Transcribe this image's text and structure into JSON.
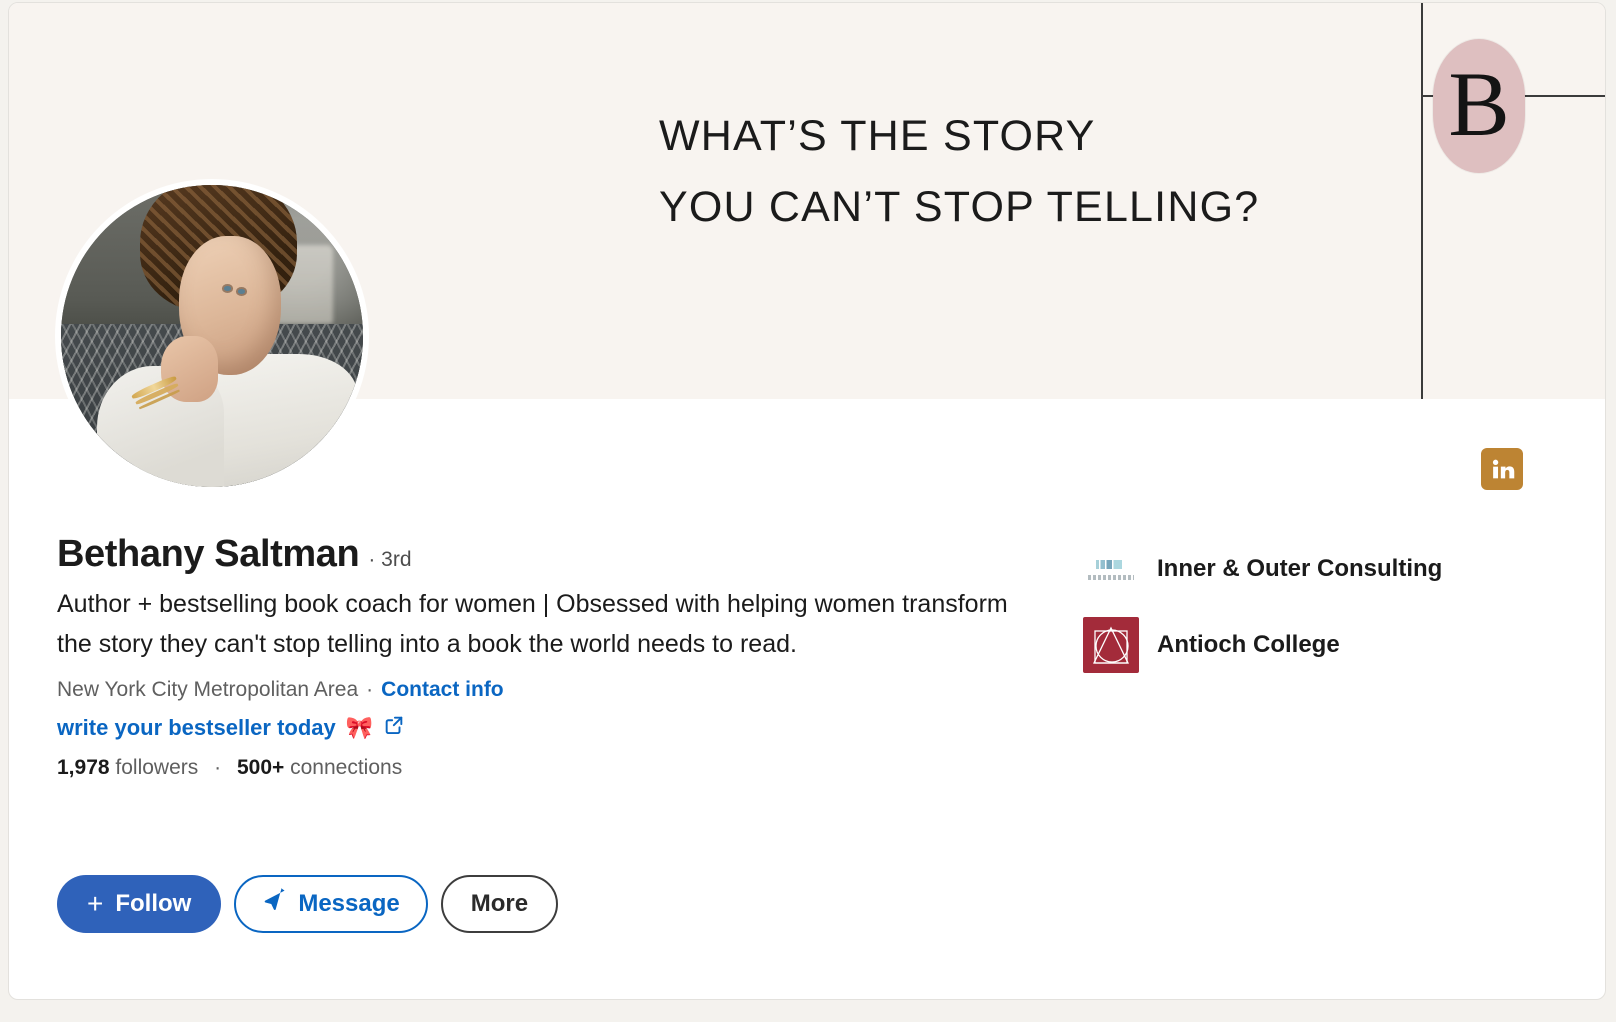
{
  "banner": {
    "headline_line1": "WHAT’S THE STORY",
    "headline_line2": "YOU CAN’T STOP TELLING?",
    "monogram_letter": "B",
    "background_color": "#f8f4f0",
    "monogram_color": "#debfc0"
  },
  "badge": {
    "icon": "linkedin-icon",
    "color": "#bd8433"
  },
  "profile": {
    "name": "Bethany Saltman",
    "degree": "· 3rd",
    "headline": "Author + bestselling book coach for women | Obsessed with helping women transform the story they can't stop telling into a book the world needs to read.",
    "location": "New York City Metropolitan Area",
    "separator_dot": "·",
    "contact_info_label": "Contact info",
    "website_label": "write your bestseller today",
    "website_emoji": "🎀",
    "website_icon": "external-link-icon",
    "followers_count": "1,978",
    "followers_label": "followers",
    "counts_separator": "·",
    "connections_count": "500+",
    "connections_label": "connections",
    "avatar_alt": "profile-photo"
  },
  "actions": {
    "follow_label": "Follow",
    "follow_plus": "+",
    "message_label": "Message",
    "more_label": "More",
    "primary_color": "#2f62ba",
    "link_color": "#0a66c2"
  },
  "affiliations": [
    {
      "name": "Inner & Outer Consulting",
      "logo": "inner-outer-consulting-logo",
      "type": "company"
    },
    {
      "name": "Antioch College",
      "logo": "antioch-college-logo",
      "type": "school",
      "logo_color": "#a32b3a"
    }
  ]
}
